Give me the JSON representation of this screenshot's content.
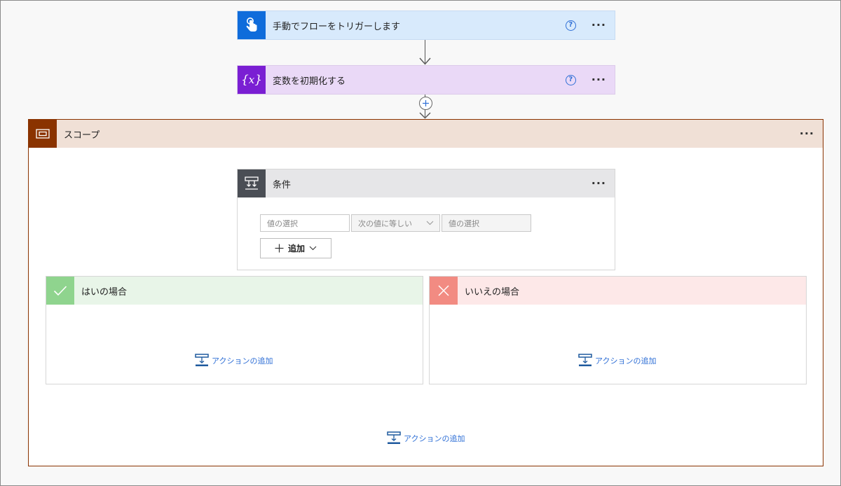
{
  "trigger": {
    "title": "手動でフローをトリガーします",
    "help": "?",
    "more": "···"
  },
  "init_var": {
    "title": "変数を初期化する",
    "help": "?",
    "more": "···"
  },
  "scope": {
    "title": "スコープ",
    "more": "···",
    "add_action": "アクションの追加"
  },
  "condition": {
    "title": "条件",
    "more": "···",
    "left_placeholder": "値の選択",
    "operator": "次の値に等しい",
    "right_placeholder": "値の選択",
    "add_label": "追加"
  },
  "yes_branch": {
    "title": "はいの場合",
    "add_action": "アクションの追加"
  },
  "no_branch": {
    "title": "いいえの場合",
    "add_action": "アクションの追加"
  },
  "colors": {
    "trigger_accent": "#0f6cdb",
    "trigger_bg": "#d8eafc",
    "var_accent": "#7a1fd3",
    "var_bg": "#ead9f7",
    "scope_accent": "#8a3300",
    "scope_bg": "#f0e0d6",
    "cond_accent": "#4a4e55",
    "cond_bg": "#e6e6e8",
    "yes_accent": "#8fd48e",
    "yes_bg": "#e8f5e8",
    "no_accent": "#f28b82",
    "no_bg": "#fde8e8",
    "link": "#2f6fd6"
  }
}
